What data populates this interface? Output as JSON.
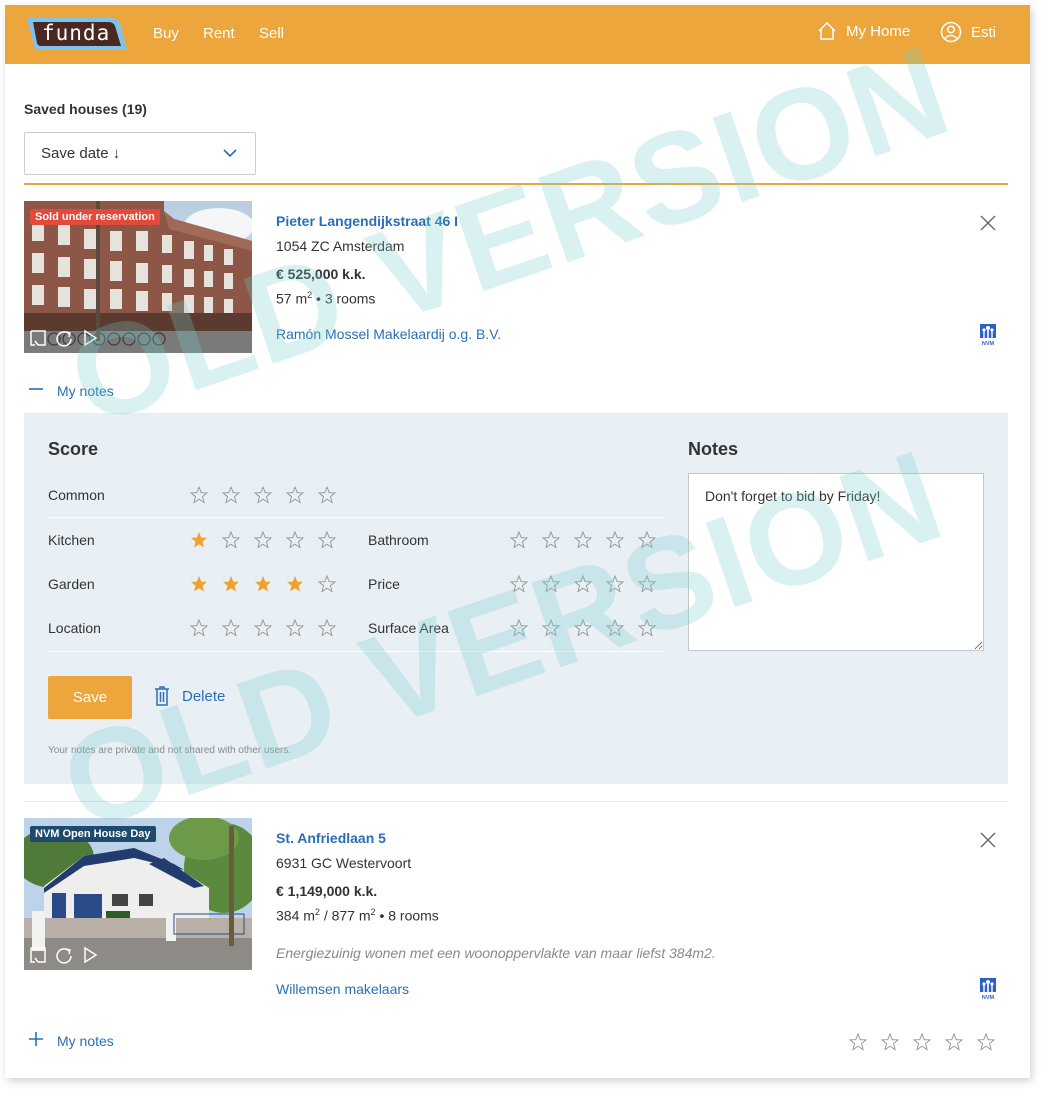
{
  "header": {
    "logo_text": "funda",
    "nav": [
      "Buy",
      "Rent",
      "Sell"
    ],
    "my_home_label": "My Home",
    "user_name": "Esti"
  },
  "saved": {
    "title": "Saved houses (19)",
    "sort_value": "Save date ↓"
  },
  "listings": [
    {
      "badge": "Sold under reservation",
      "badge_color": "#e24a3b",
      "title": "Pieter Langendijkstraat 46 I",
      "postal_city": "1054 ZC Amsterdam",
      "price": "€ 525,000 k.k.",
      "area": "57 m",
      "area_sup": "2",
      "rooms": "• 3 rooms",
      "agent": "Ramón Mossel Makelaardij o.g. B.V.",
      "notes_toggle": "My notes",
      "notes_expanded": true
    },
    {
      "badge": "NVM Open House Day",
      "badge_color": "#1e4a6e",
      "title": "St. Anfriedlaan 5",
      "postal_city": "6931 GC Westervoort",
      "price": "€ 1,149,000 k.k.",
      "area": "384 m",
      "area_sup": "2",
      "plot": "/ 877 m",
      "plot_sup": "2",
      "rooms": "• 8 rooms",
      "description": "Energiezuinig wonen met een woonoppervlakte van maar liefst 384m2.",
      "agent": "Willemsen makelaars",
      "notes_toggle": "My notes",
      "notes_expanded": false,
      "overall_rating": 0
    }
  ],
  "notes_panel": {
    "score_title": "Score",
    "notes_title": "Notes",
    "max_stars": 5,
    "ratings": [
      {
        "label": "Common",
        "value": 0
      },
      {
        "label": "Kitchen",
        "value": 1
      },
      {
        "label": "Bathroom",
        "value": 0
      },
      {
        "label": "Garden",
        "value": 4
      },
      {
        "label": "Price",
        "value": 0
      },
      {
        "label": "Location",
        "value": 0
      },
      {
        "label": "Surface Area",
        "value": 0
      }
    ],
    "notes_text": "Don't forget to bid by Friday!",
    "save_label": "Save",
    "delete_label": "Delete",
    "privacy_text": "Your notes are private and not shared with other users."
  },
  "watermark_text": "OLD VERSION",
  "colors": {
    "brand_orange": "#eca63b",
    "link_blue": "#2a6fb5",
    "star_filled": "#f0a030",
    "panel_bg": "#e8f0f6",
    "logo_bg": "#4a2721",
    "logo_border": "#7cc4ee"
  }
}
